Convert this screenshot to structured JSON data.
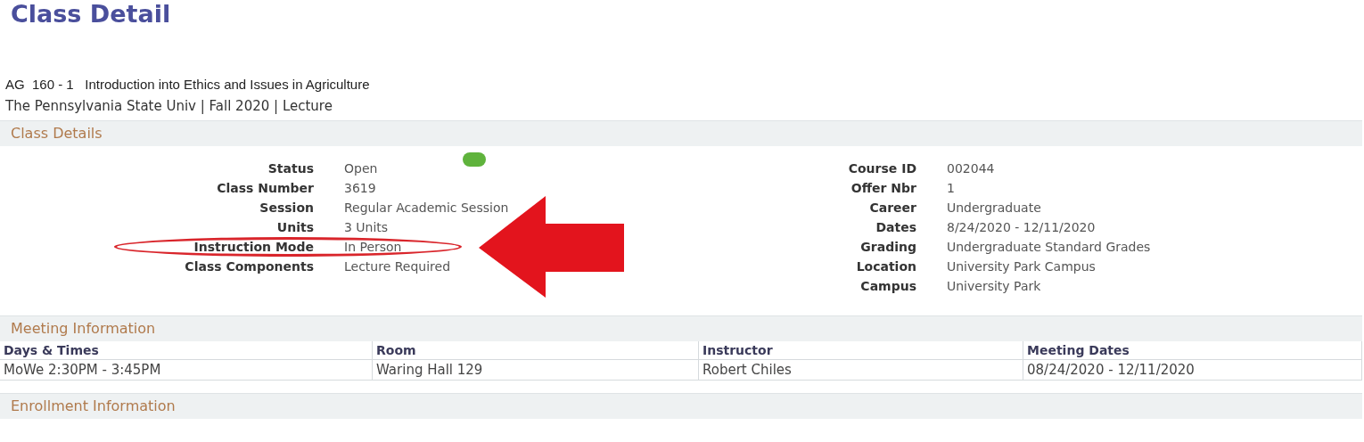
{
  "page_title": "Class Detail",
  "course_line": "AG  160 - 1   Introduction into Ethics and Issues in Agriculture",
  "course_subline": "The Pennsylvania State Univ | Fall 2020 | Lecture",
  "class_details": {
    "heading": "Class Details",
    "status_indicator": {
      "color": "#5fb33c"
    },
    "left_fields": [
      {
        "label": "Status",
        "value": "Open",
        "circled": false
      },
      {
        "label": "Class Number",
        "value": "3619",
        "circled": false
      },
      {
        "label": "Session",
        "value": "Regular Academic Session",
        "circled": false
      },
      {
        "label": "Units",
        "value": "3 Units",
        "circled": false
      },
      {
        "label": "Instruction Mode",
        "value": "In Person",
        "circled": true
      },
      {
        "label": "Class Components",
        "value": "Lecture Required",
        "circled": false
      }
    ],
    "right_fields": [
      {
        "label": "Course ID",
        "value": "002044"
      },
      {
        "label": "Offer Nbr",
        "value": "1"
      },
      {
        "label": "Career",
        "value": "Undergraduate"
      },
      {
        "label": "Dates",
        "value": "8/24/2020 - 12/11/2020"
      },
      {
        "label": "Grading",
        "value": "Undergraduate Standard Grades"
      },
      {
        "label": "Location",
        "value": "University Park Campus"
      },
      {
        "label": "Campus",
        "value": "University Park"
      }
    ]
  },
  "meeting_information": {
    "heading": "Meeting Information",
    "columns": [
      "Days & Times",
      "Room",
      "Instructor",
      "Meeting Dates"
    ],
    "rows": [
      [
        "MoWe 2:30PM - 3:45PM",
        "Waring Hall 129",
        "Robert Chiles",
        "08/24/2020 - 12/11/2020"
      ]
    ]
  },
  "enrollment_information": {
    "heading": "Enrollment Information"
  }
}
